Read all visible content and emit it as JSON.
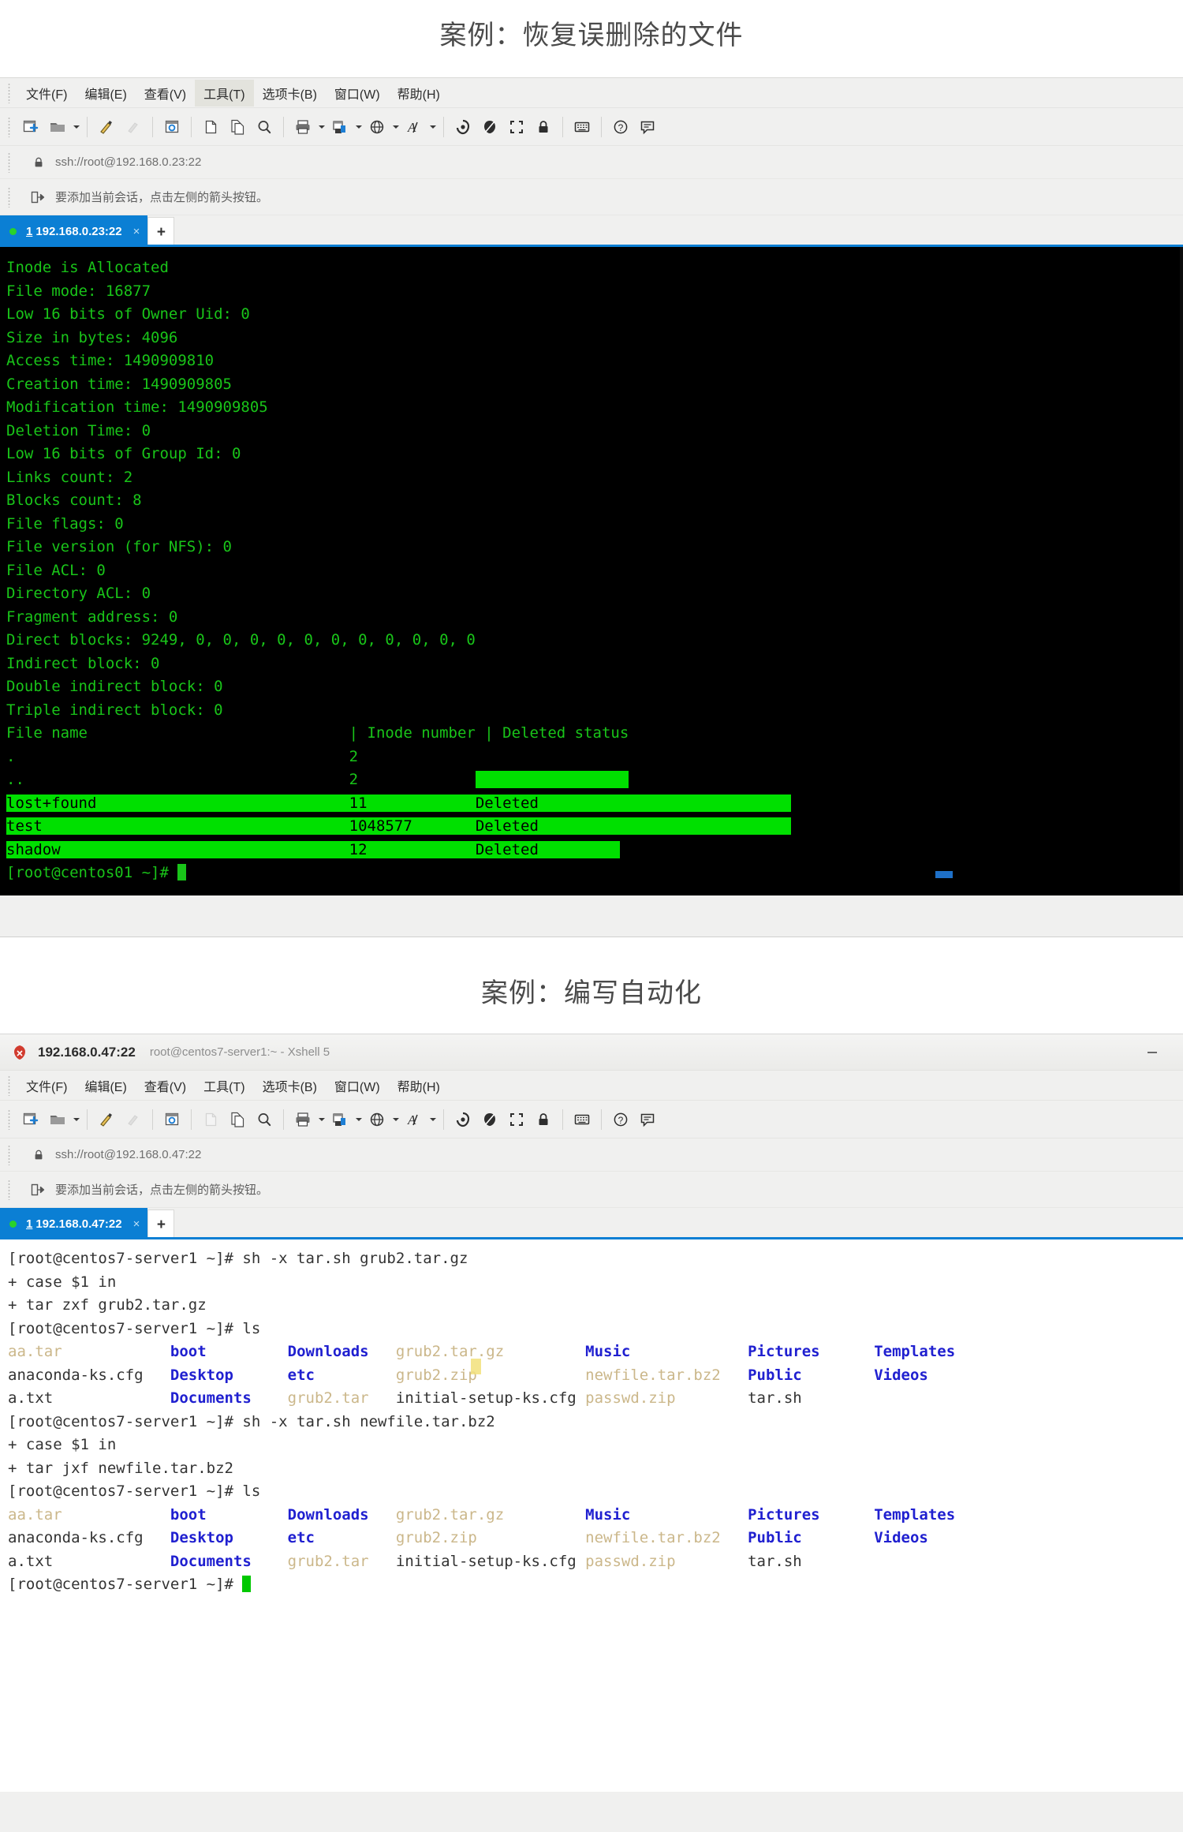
{
  "sections": [
    {
      "title": "案例：恢复误删除的文件"
    },
    {
      "title": "案例：编写自动化"
    }
  ],
  "window1": {
    "menu": [
      "文件(F)",
      "编辑(E)",
      "查看(V)",
      "工具(T)",
      "选项卡(B)",
      "窗口(W)",
      "帮助(H)"
    ],
    "address": "ssh://root@192.168.0.23:22",
    "hint": "要添加当前会话，点击左侧的箭头按钮。",
    "tab": {
      "index": "1",
      "label": "192.168.0.23:22",
      "close": "×",
      "new_tab": "+"
    },
    "terminal": {
      "lines": [
        "Inode is Allocated",
        "File mode: 16877",
        "Low 16 bits of Owner Uid: 0",
        "Size in bytes: 4096",
        "Access time: 1490909810",
        "Creation time: 1490909805",
        "Modification time: 1490909805",
        "Deletion Time: 0",
        "Low 16 bits of Group Id: 0",
        "Links count: 2",
        "Blocks count: 8",
        "File flags: 0",
        "File version (for NFS): 0",
        "File ACL: 0",
        "Directory ACL: 0",
        "Fragment address: 0",
        "Direct blocks: 9249, 0, 0, 0, 0, 0, 0, 0, 0, 0, 0, 0",
        "Indirect block: 0",
        "Double indirect block: 0",
        "Triple indirect block: 0"
      ],
      "table_header": "File name                             | Inode number | Deleted status",
      "rows": [
        {
          "name": ".",
          "inode": "2",
          "status": ""
        },
        {
          "name": "..",
          "inode": "2",
          "status": ""
        },
        {
          "name": "lost+found",
          "inode": "11",
          "status": "Deleted"
        },
        {
          "name": "test",
          "inode": "1048577",
          "status": "Deleted"
        },
        {
          "name": "shadow",
          "inode": "12",
          "status": "Deleted"
        }
      ],
      "prompt": "[root@centos01 ~]#"
    }
  },
  "window2": {
    "titlebar": {
      "host": "192.168.0.47:22",
      "subtitle": "root@centos7-server1:~ - Xshell 5",
      "minimize": "–"
    },
    "menu": [
      "文件(F)",
      "编辑(E)",
      "查看(V)",
      "工具(T)",
      "选项卡(B)",
      "窗口(W)",
      "帮助(H)"
    ],
    "address": "ssh://root@192.168.0.47:22",
    "hint": "要添加当前会话，点击左侧的箭头按钮。",
    "tab": {
      "index": "1",
      "label": "192.168.0.47:22",
      "close": "×",
      "new_tab": "+"
    },
    "terminal": {
      "l1": "[root@centos7-server1 ~]# sh -x tar.sh grub2.tar.gz",
      "l2": "+ case $1 in",
      "l3": "+ tar zxf grub2.tar.gz",
      "l4": "[root@centos7-server1 ~]# ls",
      "ls1": {
        "c1": "aa.tar",
        "c2": "boot",
        "c3": "Downloads",
        "c4": "grub2.tar.gz",
        "c5": "Music",
        "c6": "Pictures",
        "c7": "Templates"
      },
      "ls2": {
        "c1": "anaconda-ks.cfg",
        "c2": "Desktop",
        "c3": "etc",
        "c4": "grub2.zip",
        "c5": "newfile.tar.bz2",
        "c6": "Public",
        "c7": "Videos"
      },
      "ls3": {
        "c1": "a.txt",
        "c2": "Documents",
        "c3": "grub2.tar",
        "c4": "initial-setup-ks.cfg",
        "c5": "passwd.zip",
        "c6": "tar.sh",
        "c7": ""
      },
      "l5": "[root@centos7-server1 ~]# sh -x tar.sh newfile.tar.bz2",
      "l6": "+ case $1 in",
      "l7": "+ tar jxf newfile.tar.bz2",
      "l8": "[root@centos7-server1 ~]# ls",
      "l9": "[root@centos7-server1 ~]#"
    }
  },
  "colors": {
    "tab_active": "#0b7fd4",
    "terminal_green": "#19c419",
    "selection_green": "#00e000",
    "directory_blue": "#2020d0",
    "archive_tan": "#cbb78a",
    "title_gray": "#4a4a4a"
  }
}
